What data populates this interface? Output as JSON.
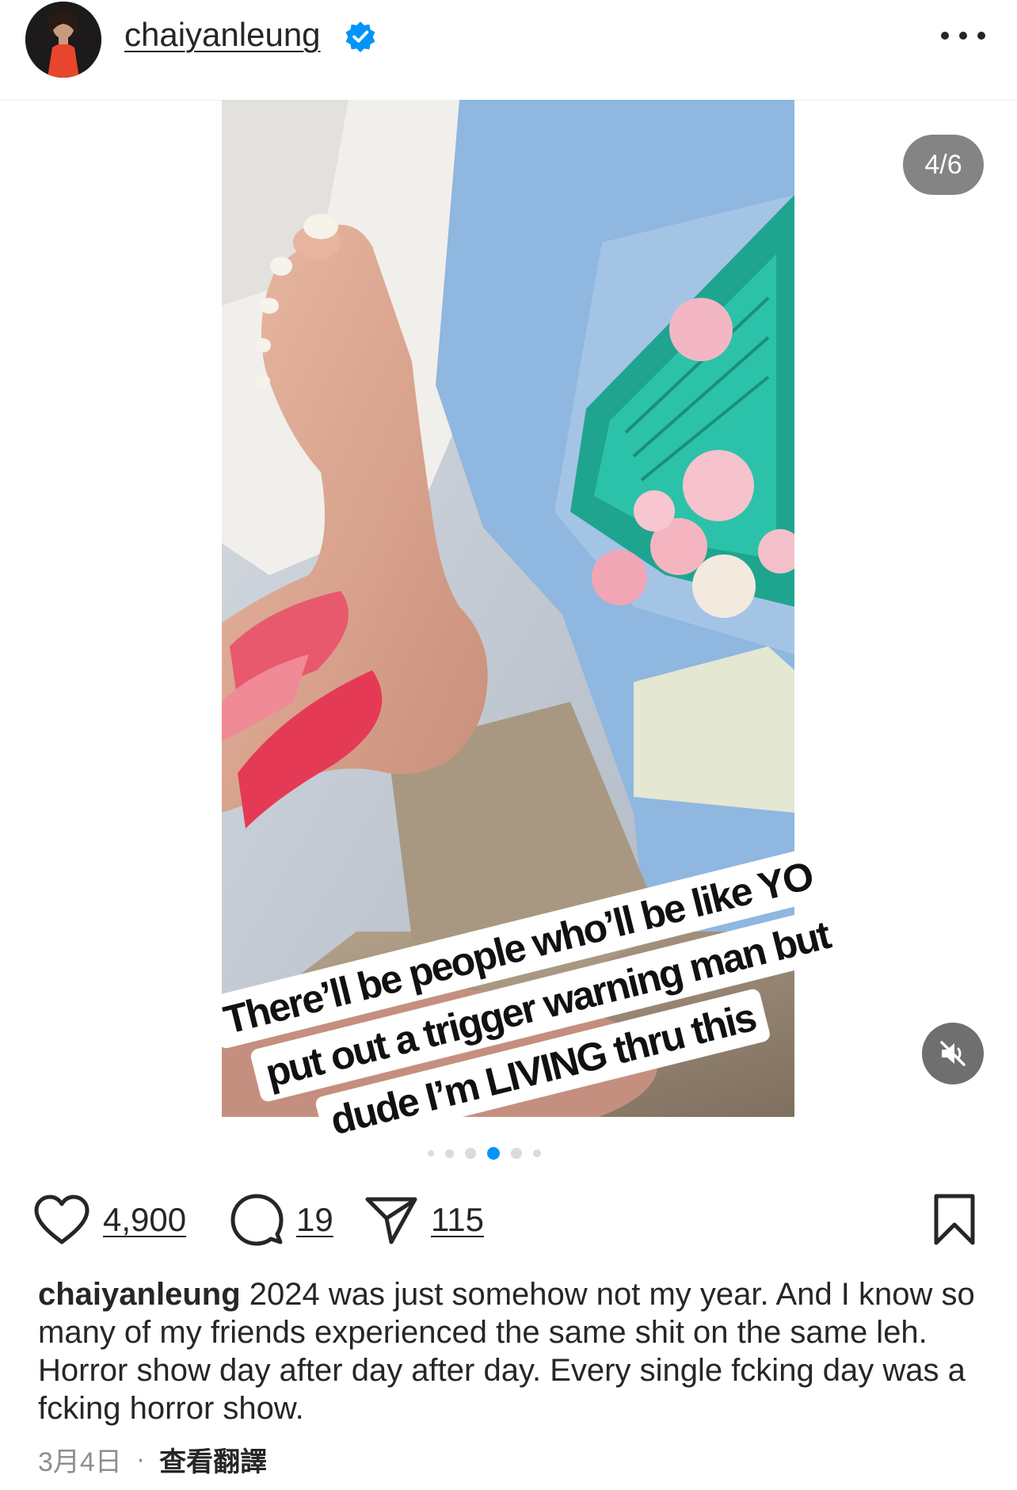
{
  "header": {
    "username": "chaiyanleung",
    "verified": true,
    "more_icon": "more-horizontal-icon"
  },
  "media": {
    "counter": "4/6",
    "overlay_lines": [
      "There’ll be people who’ll be like YO",
      "put out a trigger warning man but",
      "dude I’m LIVING thru this"
    ],
    "mute_icon": "speaker-muted-icon",
    "carousel_total": 6,
    "carousel_active_index": 3
  },
  "actions": {
    "like_icon": "heart-icon",
    "likes": "4,900",
    "comment_icon": "comment-bubble-icon",
    "comments": "19",
    "share_icon": "send-paper-plane-icon",
    "shares": "115",
    "save_icon": "bookmark-icon"
  },
  "caption": {
    "username": "chaiyanleung",
    "text": " 2024 was just somehow not my year. And I know so many of my friends experienced the same shit on the same leh. Horror show day after day after day. Every single fcking day was a fcking horror show."
  },
  "meta": {
    "date": "3月4日",
    "separator": "·",
    "translate": "查看翻譯"
  },
  "colors": {
    "accent": "#0095f6",
    "verified_blue": "#0095f6",
    "text": "#262626",
    "muted": "#8e8e8e"
  }
}
